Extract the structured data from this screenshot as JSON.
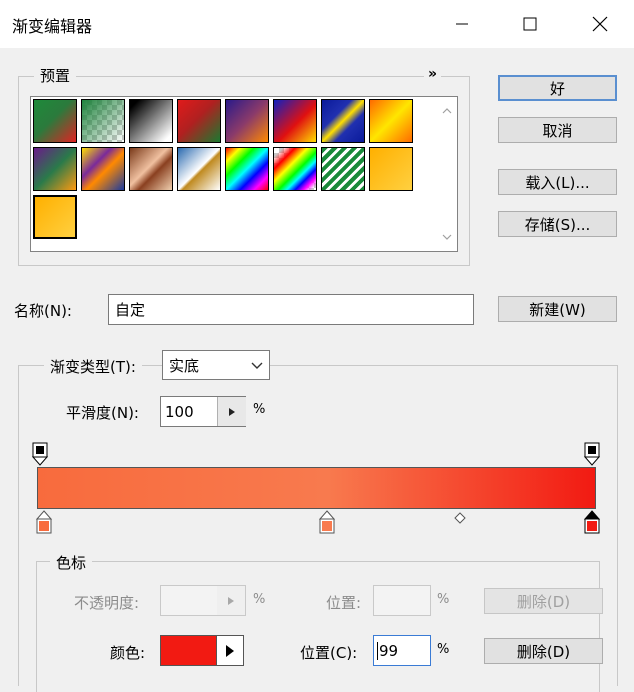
{
  "window": {
    "title": "渐变编辑器"
  },
  "presets": {
    "legend": "预置",
    "swatches": [
      {
        "name": "green-red"
      },
      {
        "name": "green-transparent"
      },
      {
        "name": "black-white"
      },
      {
        "name": "red-green"
      },
      {
        "name": "violet-orange"
      },
      {
        "name": "blue-red-yellow"
      },
      {
        "name": "blue-yellow-blue"
      },
      {
        "name": "orange-yellow-orange"
      },
      {
        "name": "violet-green-orange"
      },
      {
        "name": "yellow-violet-orange-blue"
      },
      {
        "name": "copper"
      },
      {
        "name": "chrome"
      },
      {
        "name": "spectrum"
      },
      {
        "name": "transparent-rainbow"
      },
      {
        "name": "transparent-stripes"
      },
      {
        "name": "orange-gold-1"
      },
      {
        "name": "orange-gold-2"
      }
    ]
  },
  "buttons": {
    "ok": "好",
    "cancel": "取消",
    "load": "载入(L)...",
    "save": "存储(S)...",
    "new": "新建(W)",
    "delete": "删除(D)"
  },
  "name_field": {
    "label": "名称(N):",
    "value": "自定"
  },
  "gradient": {
    "type_label": "渐变类型(T):",
    "type_value": "实底",
    "smooth_label": "平滑度(N):",
    "smooth_value": "100",
    "percent": "%",
    "colors": {
      "start": "#f86b3d",
      "end": "#f21a12"
    }
  },
  "stops": {
    "legend": "色标",
    "opacity_label": "不透明度:",
    "opacity_unit": "%",
    "opacity_position_label": "位置:",
    "opacity_position_unit": "%",
    "color_label": "颜色:",
    "color_value": "#f21a12",
    "color_position_label": "位置(C):",
    "color_position_value": "99",
    "color_position_unit": "%"
  }
}
